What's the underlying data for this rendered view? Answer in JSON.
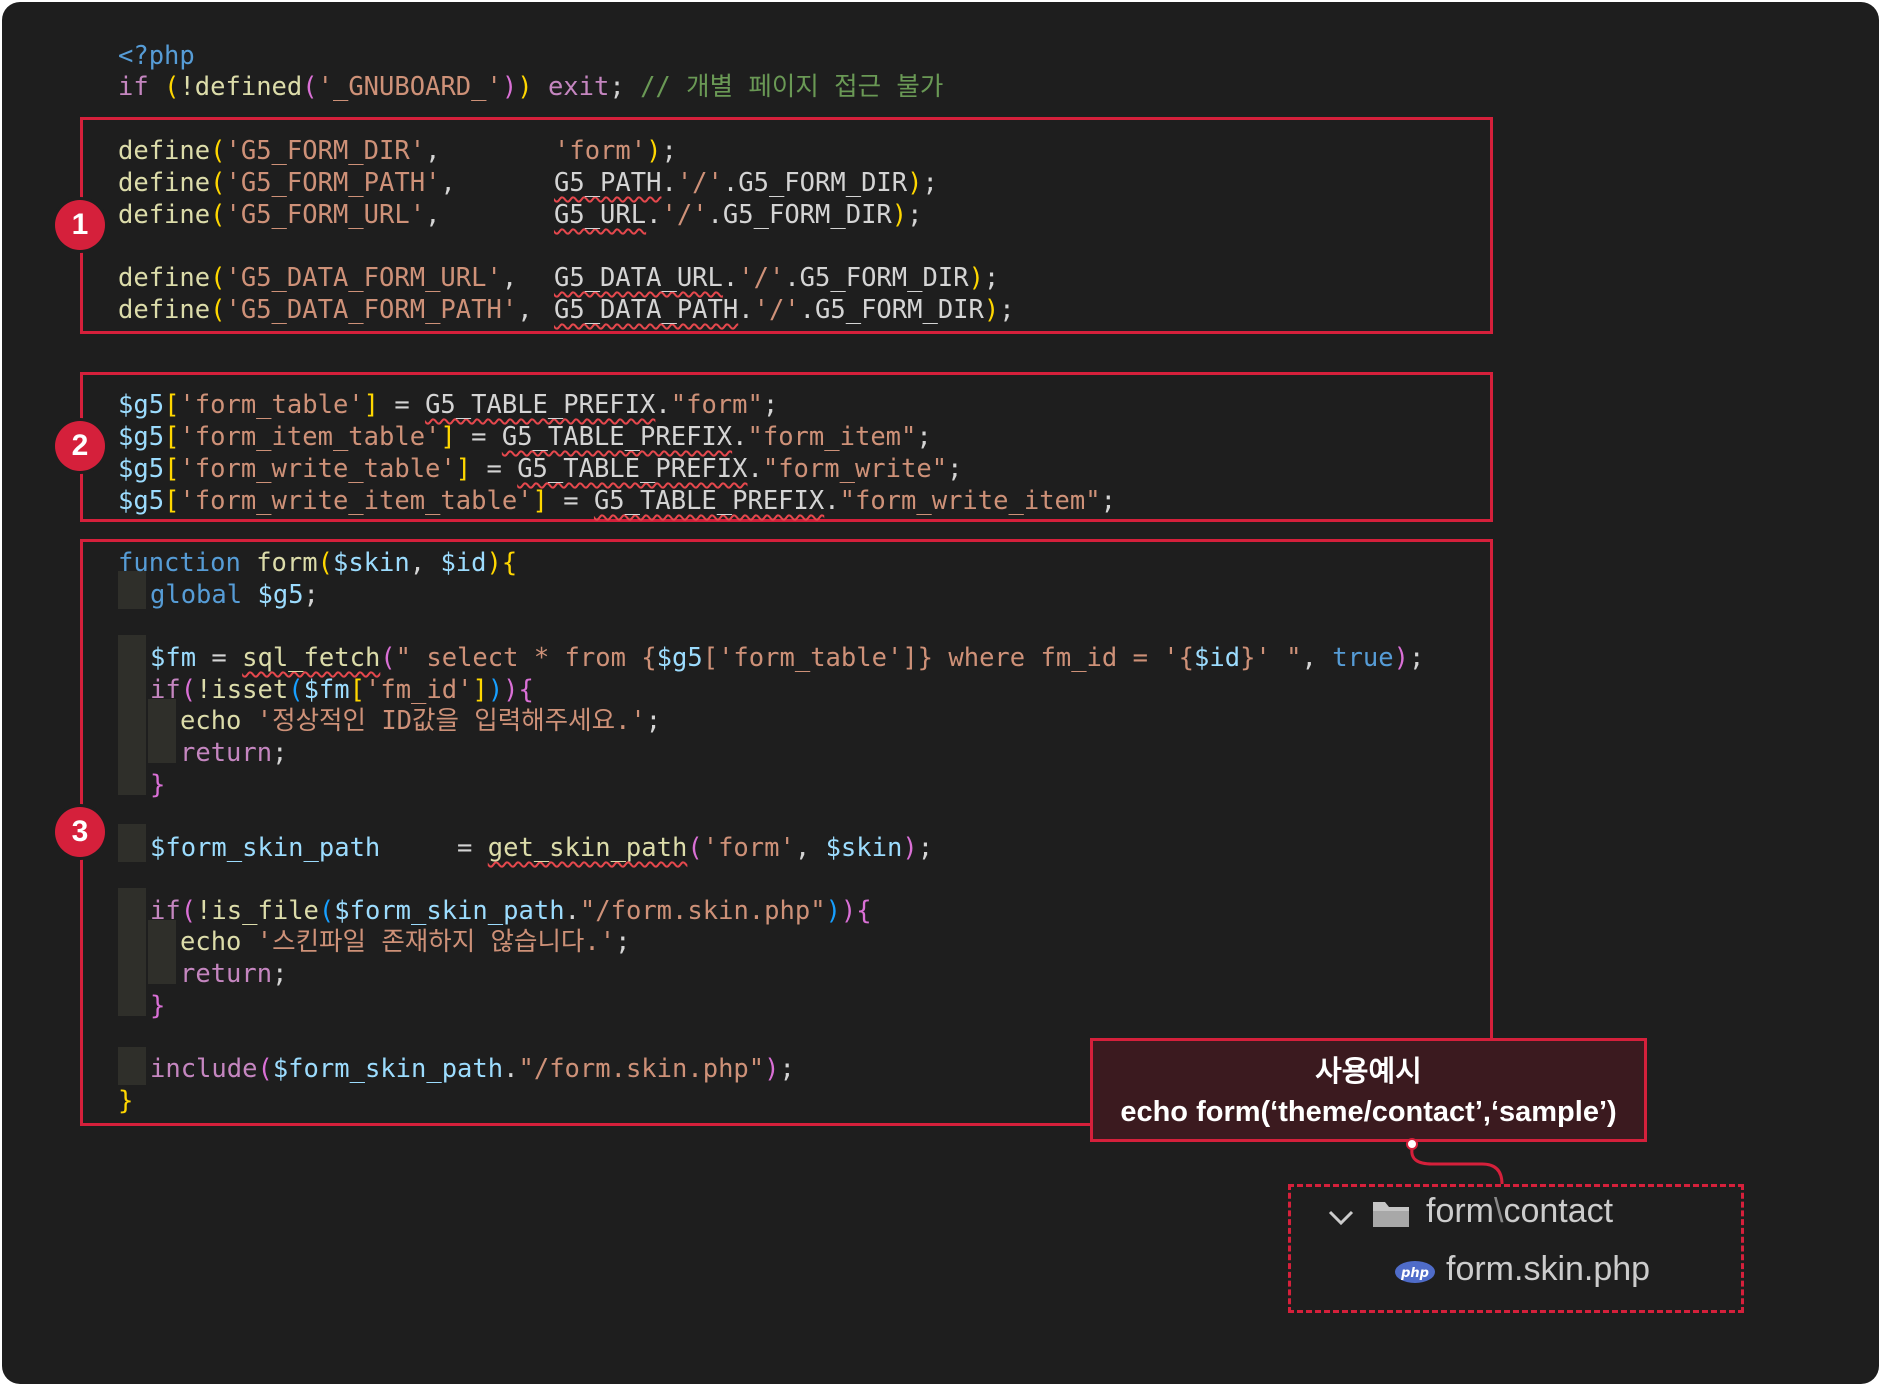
{
  "editor": {
    "header": {
      "php_open": "<?php",
      "guard_if": "if",
      "guard_defined": "!defined",
      "guard_const": "'_GNUBOARD_'",
      "guard_exit": "exit",
      "guard_comment": "// 개별 페이지 접근 불가"
    },
    "section1": {
      "badge": "1",
      "defines": [
        {
          "kw": "define",
          "name": "'G5_FORM_DIR'",
          "value": "'form'"
        },
        {
          "kw": "define",
          "name": "'G5_FORM_PATH'",
          "base": "G5_PATH",
          "sep": "'/'",
          "dir": "G5_FORM_DIR"
        },
        {
          "kw": "define",
          "name": "'G5_FORM_URL'",
          "base": "G5_URL",
          "sep": "'/'",
          "dir": "G5_FORM_DIR"
        },
        {
          "kw": "define",
          "name": "'G5_DATA_FORM_URL'",
          "base": "G5_DATA_URL",
          "sep": "'/'",
          "dir": "G5_FORM_DIR"
        },
        {
          "kw": "define",
          "name": "'G5_DATA_FORM_PATH'",
          "base": "G5_DATA_PATH",
          "sep": "'/'",
          "dir": "G5_FORM_DIR"
        }
      ]
    },
    "section2": {
      "badge": "2",
      "tables": [
        {
          "var": "$g5",
          "key": "'form_table'",
          "prefix": "G5_TABLE_PREFIX",
          "value": "\"form\""
        },
        {
          "var": "$g5",
          "key": "'form_item_table'",
          "prefix": "G5_TABLE_PREFIX",
          "value": "\"form_item\""
        },
        {
          "var": "$g5",
          "key": "'form_write_table'",
          "prefix": "G5_TABLE_PREFIX",
          "value": "\"form_write\""
        },
        {
          "var": "$g5",
          "key": "'form_write_item_table'",
          "prefix": "G5_TABLE_PREFIX",
          "value": "\"form_write_item\""
        }
      ]
    },
    "section3": {
      "badge": "3",
      "fn_keyword": "function",
      "fn_name": "form",
      "param_skin": "$skin",
      "param_id": "$id",
      "global_kw": "global",
      "global_var": "$g5",
      "fm_var": "$fm",
      "sql_fetch": "sql_fetch",
      "query_a": "\" select * from {",
      "query_g5": "$g5",
      "query_key": "'form_table'",
      "query_b": "]} where fm_id = '{",
      "query_id": "$id",
      "query_c": "}' \"",
      "true_kw": "true",
      "if_kw": "if",
      "isset_fn": "!isset",
      "fm_id_key": "'fm_id'",
      "echo_kw": "echo",
      "msg_invalid_id": "'정상적인 ID값을 입력해주세요.'",
      "return_kw": "return",
      "skin_path_var": "$form_skin_path",
      "get_skin_path": "get_skin_path",
      "skin_type": "'form'",
      "is_file_fn": "!is_file",
      "skin_file": "\"/form.skin.php\"",
      "msg_no_skin": "'스킨파일 존재하지 않습니다.'",
      "include_kw": "include"
    }
  },
  "callout": {
    "title": "사용예시",
    "example": "echo form(‘theme/contact’,‘sample’)"
  },
  "explorer": {
    "folder": "form",
    "separator": "\\",
    "subfolder": "contact",
    "file": "form.skin.php",
    "file_icon_label": "php"
  },
  "colors": {
    "background": "#1e1e1e",
    "accent": "#d5203b",
    "keyword": "#569cd6",
    "string": "#ce9178",
    "function": "#dcdcaa",
    "variable": "#9cdcfe",
    "comment": "#6a9955"
  }
}
